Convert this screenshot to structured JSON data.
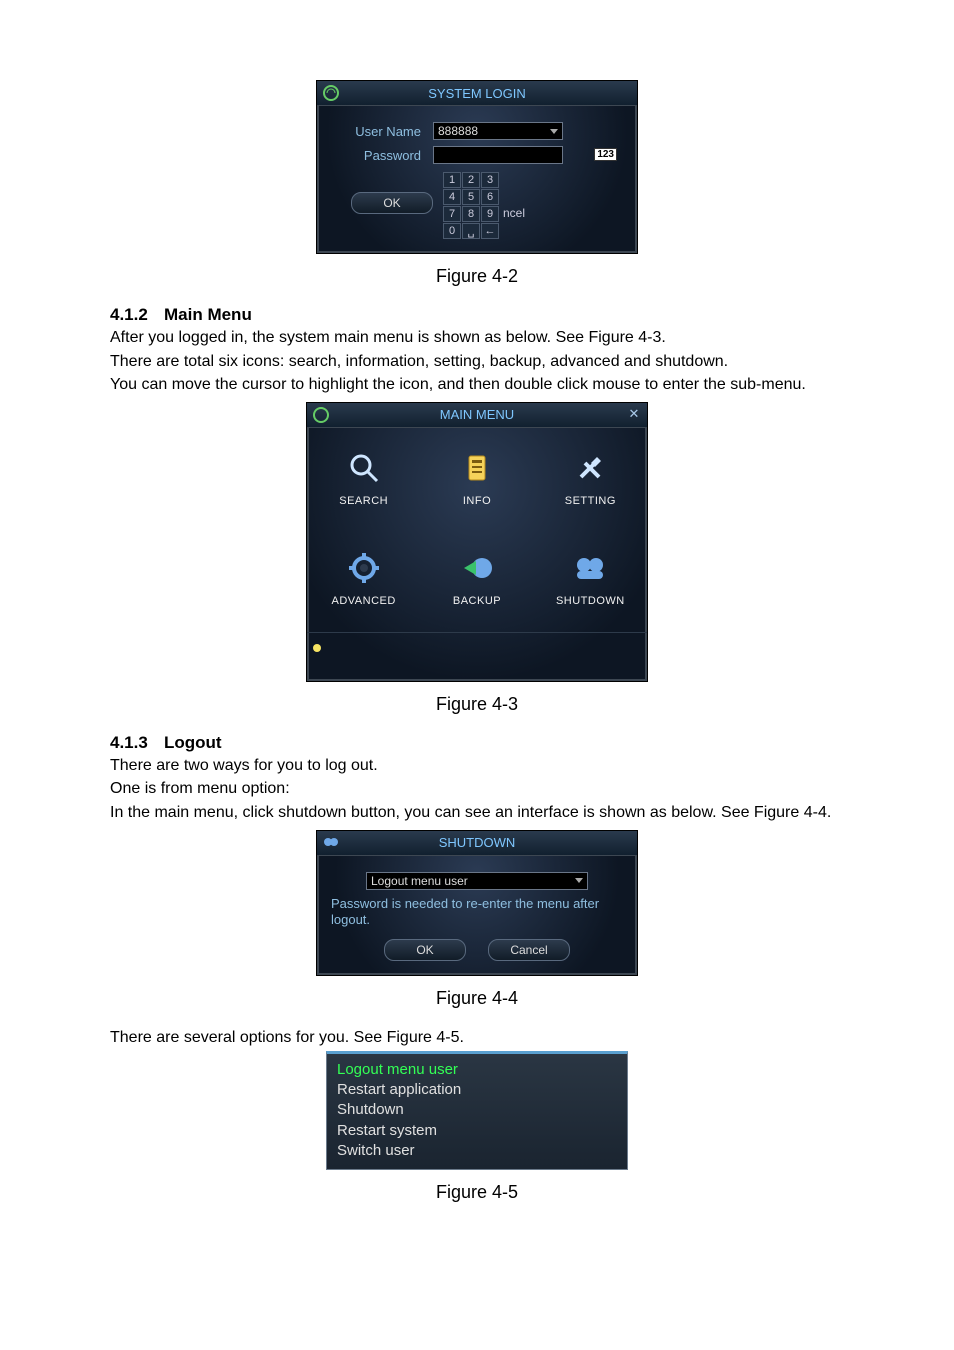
{
  "login": {
    "title": "SYSTEM LOGIN",
    "user_label": "User Name",
    "user_value": "888888",
    "password_label": "Password",
    "ok_label": "OK",
    "ime_badge": "123",
    "keypad": [
      "1",
      "2",
      "3",
      "4",
      "5",
      "6",
      "7",
      "8",
      "9",
      "0",
      "␣",
      "←"
    ],
    "partial_cancel": "ncel"
  },
  "figcap1": "Figure 4-2",
  "sec412": {
    "num": "4.1.2",
    "title": "Main Menu"
  },
  "para412_1": "After you logged in, the system main menu is shown as below. See Figure 4-3.",
  "para412_2": "There are total six icons: search, information, setting, backup, advanced and shutdown.",
  "para412_3": "You can move the cursor to highlight the icon, and then double click mouse to enter the sub-menu.",
  "mainmenu": {
    "title": "MAIN MENU",
    "items": [
      {
        "label": "SEARCH"
      },
      {
        "label": "INFO"
      },
      {
        "label": "SETTING"
      },
      {
        "label": "ADVANCED"
      },
      {
        "label": "BACKUP"
      },
      {
        "label": "SHUTDOWN"
      }
    ]
  },
  "figcap2": "Figure 4-3",
  "sec413": {
    "num": "4.1.3",
    "title": "Logout"
  },
  "para413_1": "There are two ways for you to log out.",
  "para413_2": "One is from menu option:",
  "para413_3": "In the main menu, click shutdown button, you can see an interface is shown as below.  See Figure 4-4.",
  "shutdown": {
    "title": "SHUTDOWN",
    "select_value": "Logout menu user",
    "hint": "Password is needed to re-enter the menu after logout.",
    "ok_label": "OK",
    "cancel_label": "Cancel"
  },
  "figcap3": "Figure 4-4",
  "para_after44": "There are several options for you. See Figure 4-5.",
  "options": [
    "Logout menu user",
    "Restart application",
    "Shutdown",
    "Restart system",
    "Switch user"
  ],
  "figcap4": "Figure 4-5"
}
